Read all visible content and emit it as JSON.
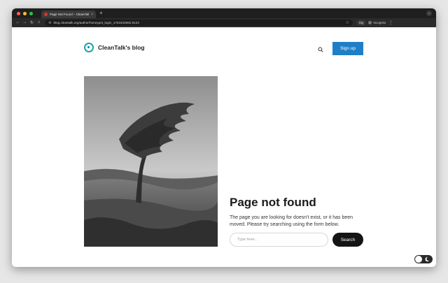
{
  "browser": {
    "tab_title": "Page Not Found – CleanTalk's",
    "tab_close": "×",
    "new_tab": "+",
    "url": "blog.cleantalk.org/author/honeypot_login_1753432662.9124",
    "profile_label": "Blg",
    "incognito_label": "Incognito",
    "traffic_colors": [
      "#ff5f57",
      "#febc2e",
      "#28c840"
    ]
  },
  "header": {
    "site_name": "CleanTalk's blog",
    "signup_label": "Sign up",
    "accent_color": "#1e7fc8"
  },
  "main": {
    "title": "Page not found",
    "description": "The page you are looking for doesn't exist, or it has been moved. Please try searching using the form below.",
    "search_placeholder": "Type here...",
    "search_button": "Search"
  },
  "icons": {
    "back": "arrow-left-icon",
    "forward": "arrow-right-icon",
    "reload": "reload-icon",
    "home": "home-icon",
    "star": "star-icon",
    "search": "search-icon",
    "theme": "moon-icon"
  }
}
